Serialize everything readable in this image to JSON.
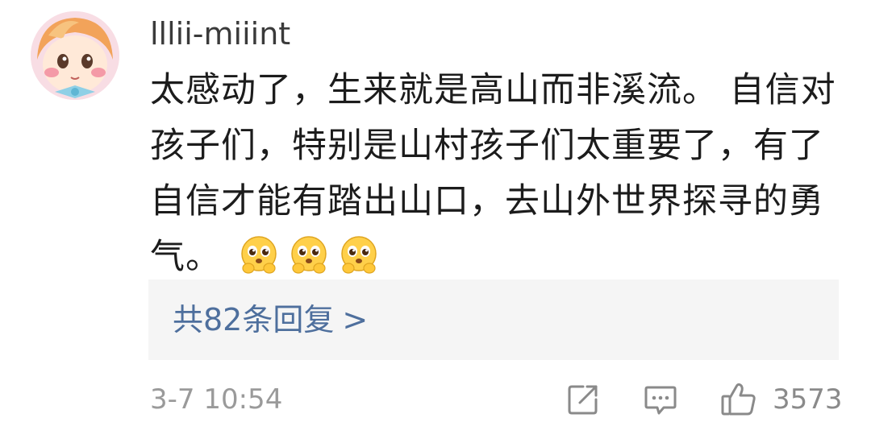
{
  "comment": {
    "username": "lllii-miiint",
    "text_lines": [
      "太感动了，生来就是高山而非溪流。 自信对",
      "孩子们，特别是山村孩子们太重要了，有了",
      "自信才能有踏出山口，去山外世界探寻的勇"
    ],
    "last_line_text": "气。",
    "emojis": [
      "pleading-face-icon",
      "pleading-face-icon",
      "pleading-face-icon"
    ],
    "replies_label": "共82条回复",
    "replies_chevron": ">",
    "timestamp": "3-7 10:54",
    "like_count": "3573"
  },
  "colors": {
    "link": "#4e6f9d",
    "replies_bg": "#f5f5f5",
    "muted_text": "#9a9a9a",
    "icon_stroke": "#8a8a8a"
  }
}
